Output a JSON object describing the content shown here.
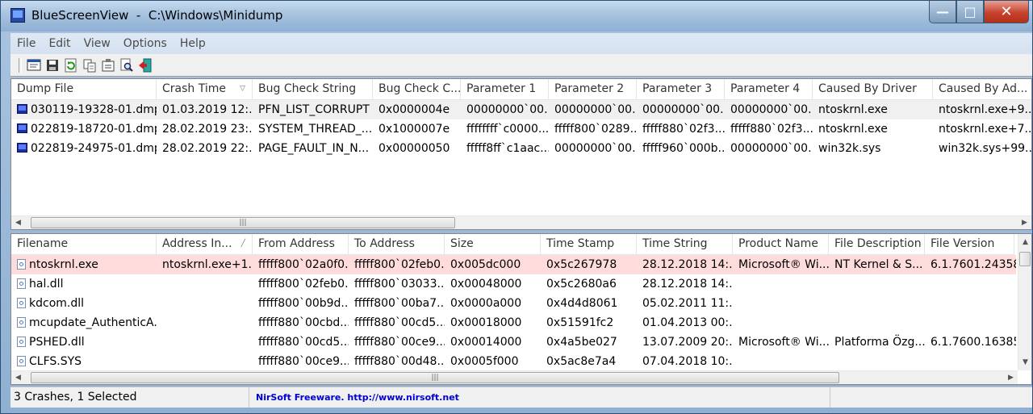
{
  "window": {
    "title": "BlueScreenView  -  C:\\Windows\\Minidump",
    "min_symbol": "—",
    "max_symbol": "□",
    "close_symbol": "✕"
  },
  "menu": [
    "File",
    "Edit",
    "View",
    "Options",
    "Help"
  ],
  "toolbar_icons": [
    "properties-icon",
    "save-icon",
    "refresh-icon",
    "copy-icon",
    "advanced-options-icon",
    "find-icon",
    "exit-icon"
  ],
  "upper": {
    "columns": [
      "Dump File",
      "Crash Time",
      "Bug Check String",
      "Bug Check C...",
      "Parameter 1",
      "Parameter 2",
      "Parameter 3",
      "Parameter 4",
      "Caused By Driver",
      "Caused By Ad..."
    ],
    "rows": [
      [
        "030119-19328-01.dmp",
        "01.03.2019 12:...",
        "PFN_LIST_CORRUPT",
        "0x0000004e",
        "00000000`00...",
        "00000000`00...",
        "00000000`00...",
        "00000000`00...",
        "ntoskrnl.exe",
        "ntoskrnl.exe+9..."
      ],
      [
        "022819-18720-01.dmp",
        "28.02.2019 23:...",
        "SYSTEM_THREAD_...",
        "0x1000007e",
        "ffffffff`c0000...",
        "fffff800`0289...",
        "fffff880`02f3...",
        "fffff880`02f3...",
        "ntoskrnl.exe",
        "ntoskrnl.exe+7..."
      ],
      [
        "022819-24975-01.dmp",
        "28.02.2019 22:...",
        "PAGE_FAULT_IN_N...",
        "0x00000050",
        "fffff8ff`c1aac...",
        "00000000`00...",
        "fffff960`000b...",
        "00000000`00...",
        "win32k.sys",
        "win32k.sys+99..."
      ]
    ]
  },
  "lower": {
    "columns": [
      "Filename",
      "Address In...",
      "From Address",
      "To Address",
      "Size",
      "Time Stamp",
      "Time String",
      "Product Name",
      "File Description",
      "File Version"
    ],
    "rows": [
      [
        "ntoskrnl.exe",
        "ntoskrnl.exe+1...",
        "fffff800`02a0f0...",
        "fffff800`02feb0...",
        "0x005dc000",
        "0x5c267978",
        "28.12.2018 14:...",
        "Microsoft® Wi...",
        "NT Kernel & S...",
        "6.1.7601.24358..."
      ],
      [
        "hal.dll",
        "",
        "fffff800`02feb0...",
        "fffff800`03033...",
        "0x00048000",
        "0x5c2680a6",
        "28.12.2018 14:...",
        "",
        "",
        ""
      ],
      [
        "kdcom.dll",
        "",
        "fffff800`00b9d...",
        "fffff800`00ba7...",
        "0x0000a000",
        "0x4d4d8061",
        "05.02.2011 11:...",
        "",
        "",
        ""
      ],
      [
        "mcupdate_AuthenticA...",
        "",
        "fffff880`00cbd...",
        "fffff880`00cd5...",
        "0x00018000",
        "0x51591fc2",
        "01.04.2013 00:...",
        "",
        "",
        ""
      ],
      [
        "PSHED.dll",
        "",
        "fffff880`00cd5...",
        "fffff880`00ce9...",
        "0x00014000",
        "0x4a5be027",
        "13.07.2009 20:...",
        "Microsoft® Wi...",
        "Platforma Özg...",
        "6.1.7600.16385..."
      ],
      [
        "CLFS.SYS",
        "",
        "fffff880`00ce9...",
        "fffff880`00d48...",
        "0x0005f000",
        "0x5ac8e7a4",
        "07.04.2018 10:...",
        "",
        "",
        ""
      ]
    ]
  },
  "scroll": {
    "left_arrow": "◀",
    "right_arrow": "▶",
    "up_arrow": "▲",
    "down_arrow": "▼",
    "grip": "|||"
  },
  "status": {
    "summary": "3 Crashes, 1 Selected",
    "link": "NirSoft Freeware.  http://www.nirsoft.net"
  },
  "colors": {
    "selected_row": "#f0f0f0",
    "highlight_row": "#ffdcdc",
    "link": "#0000d0"
  }
}
